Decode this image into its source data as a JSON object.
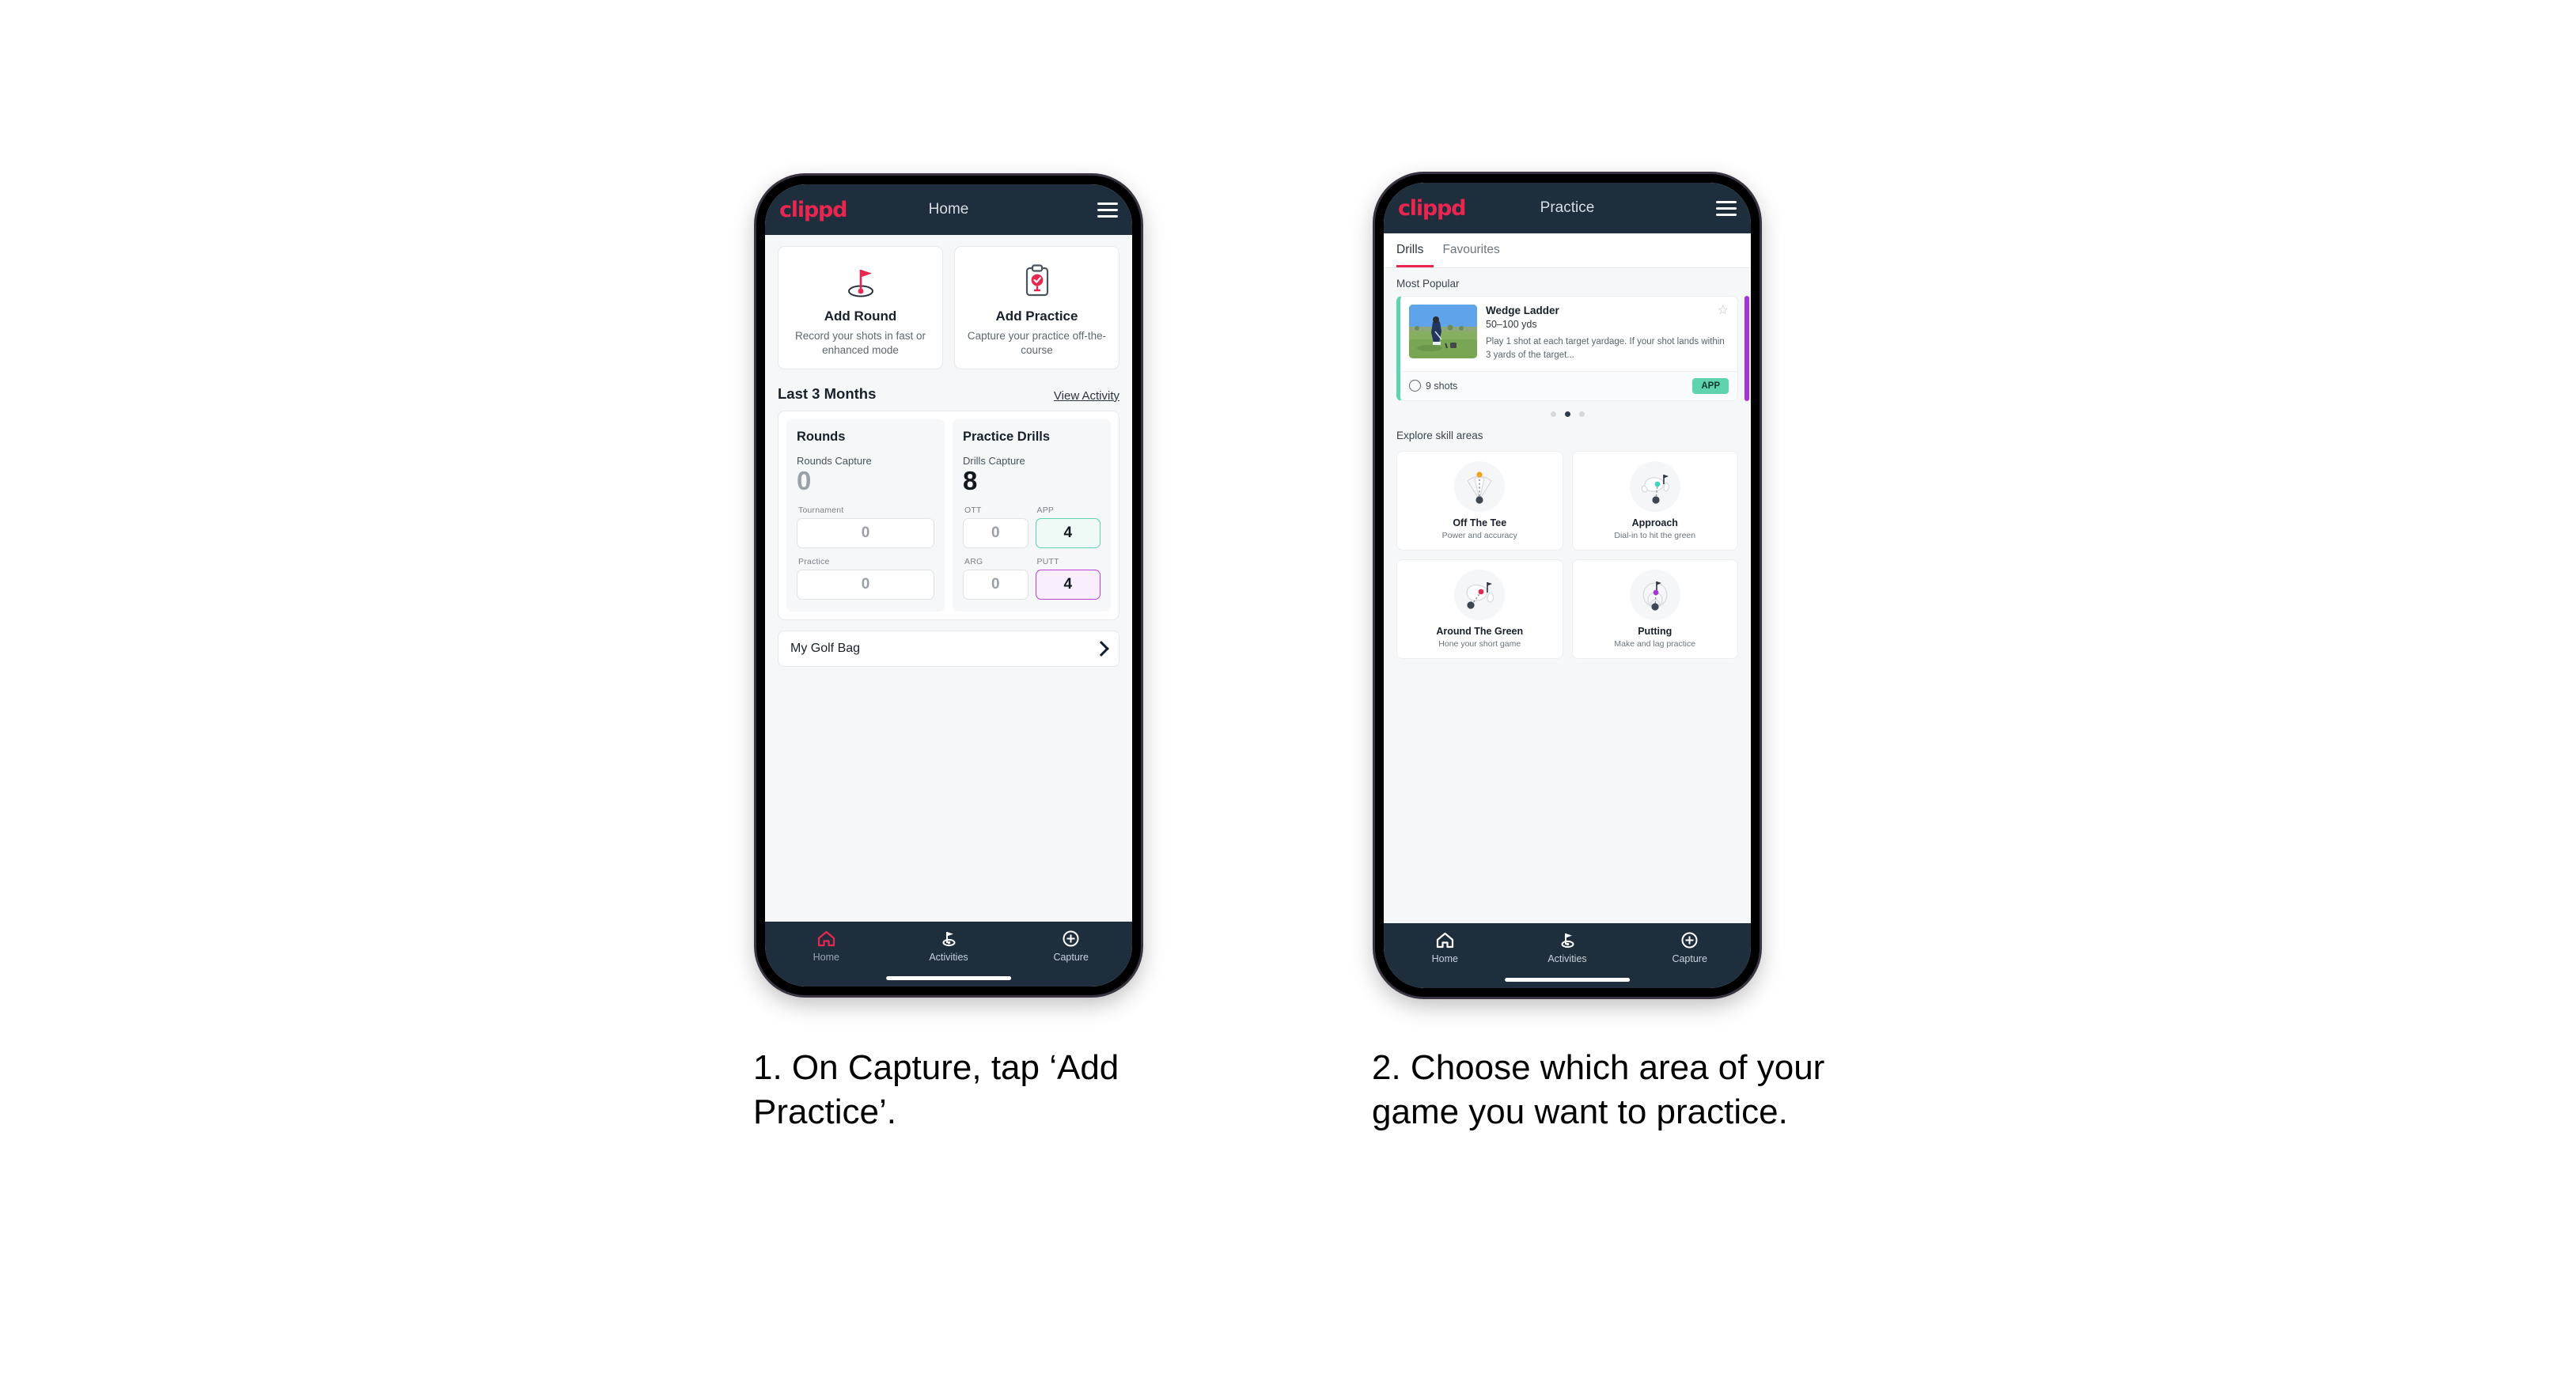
{
  "brand": {
    "logo": "clippd",
    "accent": "#e8264f",
    "navbar_bg": "#1f2e3d"
  },
  "phone1": {
    "header": {
      "logo": "clippd",
      "title": "Home",
      "menu_icon": "hamburger-menu-icon"
    },
    "actions": [
      {
        "icon": "golf-flag-hole-icon",
        "title": "Add Round",
        "desc": "Record your shots in fast or enhanced mode"
      },
      {
        "icon": "clipboard-check-tee-icon",
        "title": "Add Practice",
        "desc": "Capture your practice off-the-course"
      }
    ],
    "section": {
      "title": "Last 3 Months",
      "link": "View Activity"
    },
    "rounds": {
      "title": "Rounds",
      "capture_label": "Rounds Capture",
      "capture_value": "0",
      "fields": [
        {
          "label": "Tournament",
          "value": "0",
          "state": "default"
        },
        {
          "label": "Practice",
          "value": "0",
          "state": "default"
        }
      ]
    },
    "drills": {
      "title": "Practice Drills",
      "capture_label": "Drills Capture",
      "capture_value": "8",
      "fields": [
        {
          "label": "OTT",
          "value": "0",
          "state": "default"
        },
        {
          "label": "APP",
          "value": "4",
          "state": "green"
        },
        {
          "label": "ARG",
          "value": "0",
          "state": "default"
        },
        {
          "label": "PUTT",
          "value": "4",
          "state": "purple"
        }
      ]
    },
    "golf_bag": {
      "label": "My Golf Bag",
      "chevron": "chevron-right-icon"
    },
    "bottom_nav": [
      {
        "icon": "home-icon",
        "label": "Home",
        "active": true
      },
      {
        "icon": "golf-flag-icon",
        "label": "Activities",
        "active": false
      },
      {
        "icon": "plus-circle-icon",
        "label": "Capture",
        "active": false
      }
    ]
  },
  "phone2": {
    "header": {
      "logo": "clippd",
      "title": "Practice",
      "menu_icon": "hamburger-menu-icon"
    },
    "tabs": [
      {
        "label": "Drills",
        "active": true
      },
      {
        "label": "Favourites",
        "active": false
      }
    ],
    "most_popular_label": "Most Popular",
    "drill_card": {
      "title": "Wedge Ladder",
      "yardage": "50–100 yds",
      "description": "Play 1 shot at each target yardage. If your shot lands within 3 yards of the target...",
      "shots": "9 shots",
      "badge": "APP",
      "badge_color": "#5fd3ad",
      "accent_color": "#5fd3ad",
      "next_card_accent": "#a634d6",
      "favourite_icon": "star-outline-icon",
      "clock_icon": "clock-icon",
      "thumbnail": "golfer-chipping-photo"
    },
    "carousel_dots": {
      "count": 3,
      "active_index": 1
    },
    "skill_section_label": "Explore skill areas",
    "skills": [
      {
        "icon": "tee-shot-dispersion-icon",
        "title": "Off The Tee",
        "desc": "Power and accuracy",
        "dot_color": "#f2a413"
      },
      {
        "icon": "green-approach-icon",
        "title": "Approach",
        "desc": "Dial-in to hit the green",
        "dot_color": "#3fd3c0"
      },
      {
        "icon": "short-game-chip-icon",
        "title": "Around The Green",
        "desc": "Hone your short game",
        "dot_color": "#e8264f"
      },
      {
        "icon": "putting-rings-icon",
        "title": "Putting",
        "desc": "Make and lag practice",
        "dot_color": "#a634d6"
      }
    ],
    "bottom_nav": [
      {
        "icon": "home-icon",
        "label": "Home",
        "active": false
      },
      {
        "icon": "golf-flag-icon",
        "label": "Activities",
        "active": false
      },
      {
        "icon": "plus-circle-icon",
        "label": "Capture",
        "active": false
      }
    ]
  },
  "captions": {
    "step1": "1. On Capture, tap ‘Add Practice’.",
    "step2": "2. Choose which area of your game you want to practice."
  }
}
